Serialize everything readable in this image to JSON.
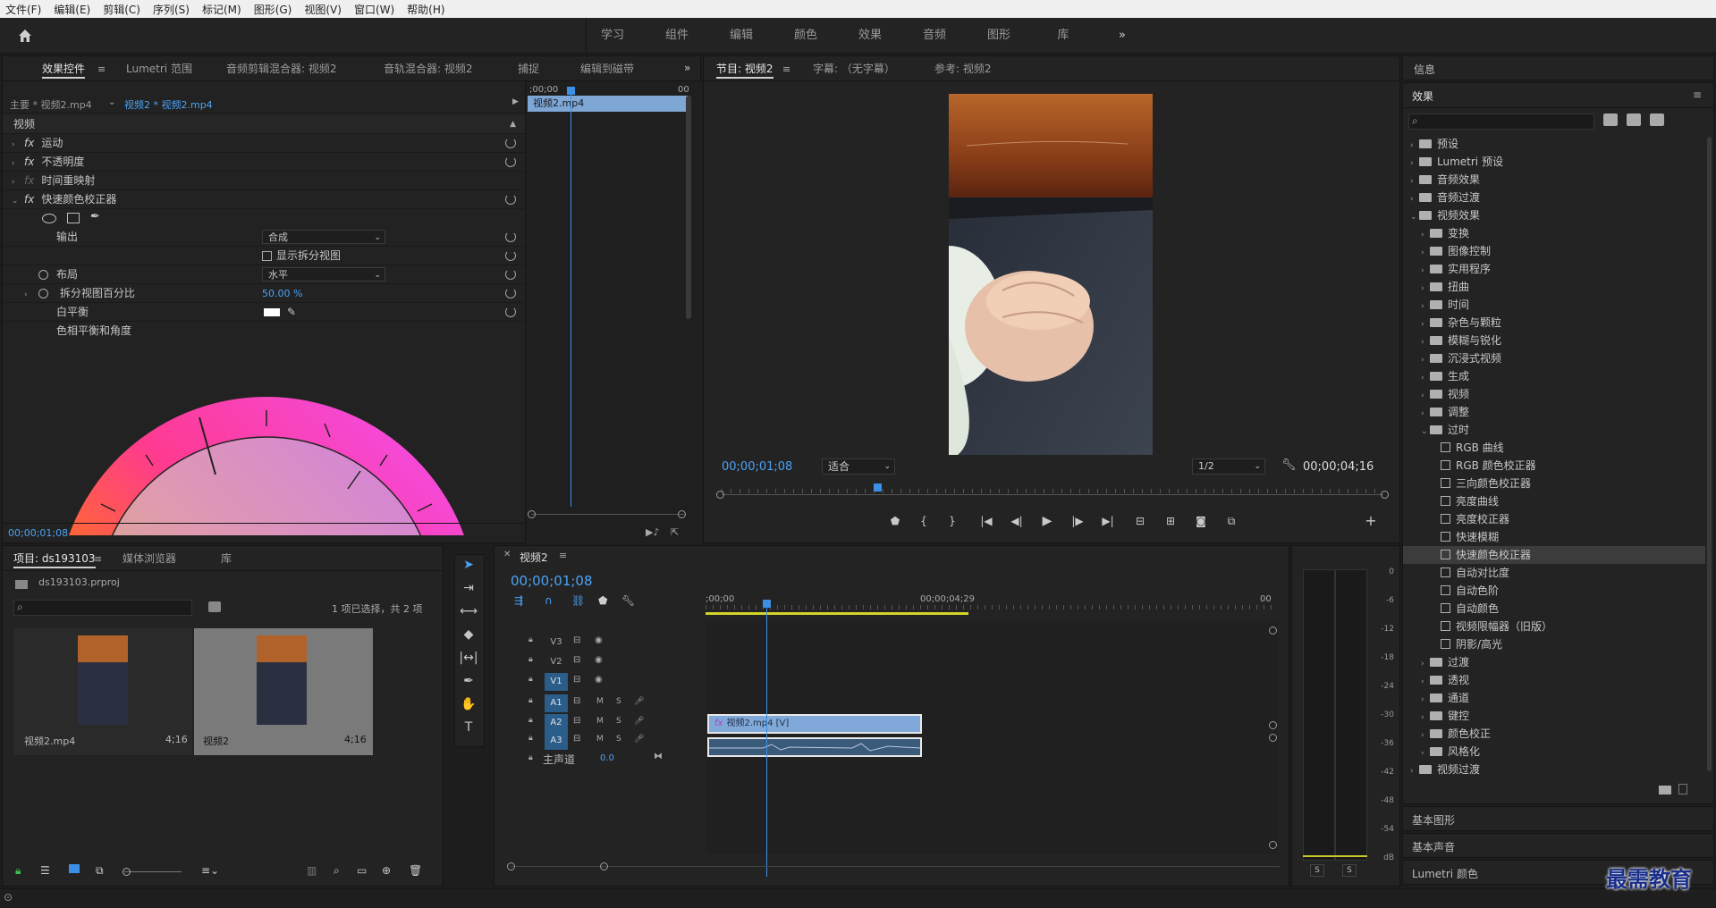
{
  "menu": [
    "文件(F)",
    "编辑(E)",
    "剪辑(C)",
    "序列(S)",
    "标记(M)",
    "图形(G)",
    "视图(V)",
    "窗口(W)",
    "帮助(H)"
  ],
  "workspaces": [
    "学习",
    "组件",
    "编辑",
    "颜色",
    "效果",
    "音频",
    "图形",
    "库"
  ],
  "effect_controls": {
    "tabs": [
      "效果控件",
      "Lumetri 范围",
      "音频剪辑混合器: 视频2",
      "音轨混合器: 视频2",
      "捕捉",
      "编辑到磁带"
    ],
    "master": "主要 * 视频2.mp4",
    "clip": "视频2 * 视频2.mp4",
    "mini_time_start": ";00;00",
    "mini_time_end": "00",
    "mini_clip": "视频2.mp4",
    "section": "视频",
    "fx": [
      "运动",
      "不透明度",
      "时间重映射",
      "快速颜色校正器"
    ],
    "output_label": "输出",
    "output_value": "合成",
    "split_label": "显示拆分视图",
    "layout_label": "布局",
    "layout_value": "水平",
    "split_pct_label": "拆分视图百分比",
    "split_pct_value": "50.00 %",
    "wb_label": "白平衡",
    "hue_label": "色相平衡和角度",
    "timecode": "00;00;01;08"
  },
  "program": {
    "tabs": [
      "节目: 视频2",
      "字幕: （无字幕）",
      "参考: 视频2"
    ],
    "timecode": "00;00;01;08",
    "fit": "适合",
    "res": "1/2",
    "duration": "00;00;04;16"
  },
  "info_label": "信息",
  "effects": {
    "title": "效果",
    "tree": [
      {
        "d": 0,
        "t": "预设",
        "k": "f",
        "o": false
      },
      {
        "d": 0,
        "t": "Lumetri 预设",
        "k": "f",
        "o": false
      },
      {
        "d": 0,
        "t": "音频效果",
        "k": "f",
        "o": false
      },
      {
        "d": 0,
        "t": "音频过渡",
        "k": "f",
        "o": false
      },
      {
        "d": 0,
        "t": "视频效果",
        "k": "f",
        "o": true
      },
      {
        "d": 1,
        "t": "变换",
        "k": "f",
        "o": false
      },
      {
        "d": 1,
        "t": "图像控制",
        "k": "f",
        "o": false
      },
      {
        "d": 1,
        "t": "实用程序",
        "k": "f",
        "o": false
      },
      {
        "d": 1,
        "t": "扭曲",
        "k": "f",
        "o": false
      },
      {
        "d": 1,
        "t": "时间",
        "k": "f",
        "o": false
      },
      {
        "d": 1,
        "t": "杂色与颗粒",
        "k": "f",
        "o": false
      },
      {
        "d": 1,
        "t": "模糊与锐化",
        "k": "f",
        "o": false
      },
      {
        "d": 1,
        "t": "沉浸式视频",
        "k": "f",
        "o": false
      },
      {
        "d": 1,
        "t": "生成",
        "k": "f",
        "o": false
      },
      {
        "d": 1,
        "t": "视频",
        "k": "f",
        "o": false
      },
      {
        "d": 1,
        "t": "调整",
        "k": "f",
        "o": false
      },
      {
        "d": 1,
        "t": "过时",
        "k": "f",
        "o": true
      },
      {
        "d": 2,
        "t": "RGB 曲线",
        "k": "e"
      },
      {
        "d": 2,
        "t": "RGB 颜色校正器",
        "k": "e"
      },
      {
        "d": 2,
        "t": "三向颜色校正器",
        "k": "e"
      },
      {
        "d": 2,
        "t": "亮度曲线",
        "k": "e"
      },
      {
        "d": 2,
        "t": "亮度校正器",
        "k": "e"
      },
      {
        "d": 2,
        "t": "快速模糊",
        "k": "e"
      },
      {
        "d": 2,
        "t": "快速颜色校正器",
        "k": "e",
        "sel": true
      },
      {
        "d": 2,
        "t": "自动对比度",
        "k": "e"
      },
      {
        "d": 2,
        "t": "自动色阶",
        "k": "e"
      },
      {
        "d": 2,
        "t": "自动颜色",
        "k": "e"
      },
      {
        "d": 2,
        "t": "视频限幅器（旧版）",
        "k": "e"
      },
      {
        "d": 2,
        "t": "阴影/高光",
        "k": "e"
      },
      {
        "d": 1,
        "t": "过渡",
        "k": "f",
        "o": false
      },
      {
        "d": 1,
        "t": "透视",
        "k": "f",
        "o": false
      },
      {
        "d": 1,
        "t": "通道",
        "k": "f",
        "o": false
      },
      {
        "d": 1,
        "t": "键控",
        "k": "f",
        "o": false
      },
      {
        "d": 1,
        "t": "颜色校正",
        "k": "f",
        "o": false
      },
      {
        "d": 1,
        "t": "风格化",
        "k": "f",
        "o": false
      },
      {
        "d": 0,
        "t": "视频过渡",
        "k": "f",
        "o": false
      }
    ],
    "collapsed": [
      "基本图形",
      "基本声音",
      "Lumetri 颜色"
    ]
  },
  "project": {
    "tabs": [
      "项目: ds193103",
      "媒体浏览器",
      "库"
    ],
    "file": "ds193103.prproj",
    "selection": "1 项已选择，共 2 项",
    "items": [
      {
        "name": "视频2.mp4",
        "dur": "4;16"
      },
      {
        "name": "视频2",
        "dur": "4;16"
      }
    ]
  },
  "timeline": {
    "tab": "视频2",
    "timecode": "00;00;01;08",
    "ruler": [
      ";00;00",
      "00;00;04;29",
      "00"
    ],
    "video_tracks": [
      "V3",
      "V2",
      "V1"
    ],
    "audio_tracks": [
      "A1",
      "A2",
      "A3"
    ],
    "master": "主声道",
    "master_val": "0.0",
    "clip_label": "视频2.mp4 [V]"
  },
  "meter": {
    "labels": [
      "0",
      "-6",
      "-12",
      "-18",
      "-24",
      "-30",
      "-36",
      "-42",
      "-48",
      "-54",
      "dB"
    ],
    "s": "S"
  },
  "watermark": "最需教育"
}
